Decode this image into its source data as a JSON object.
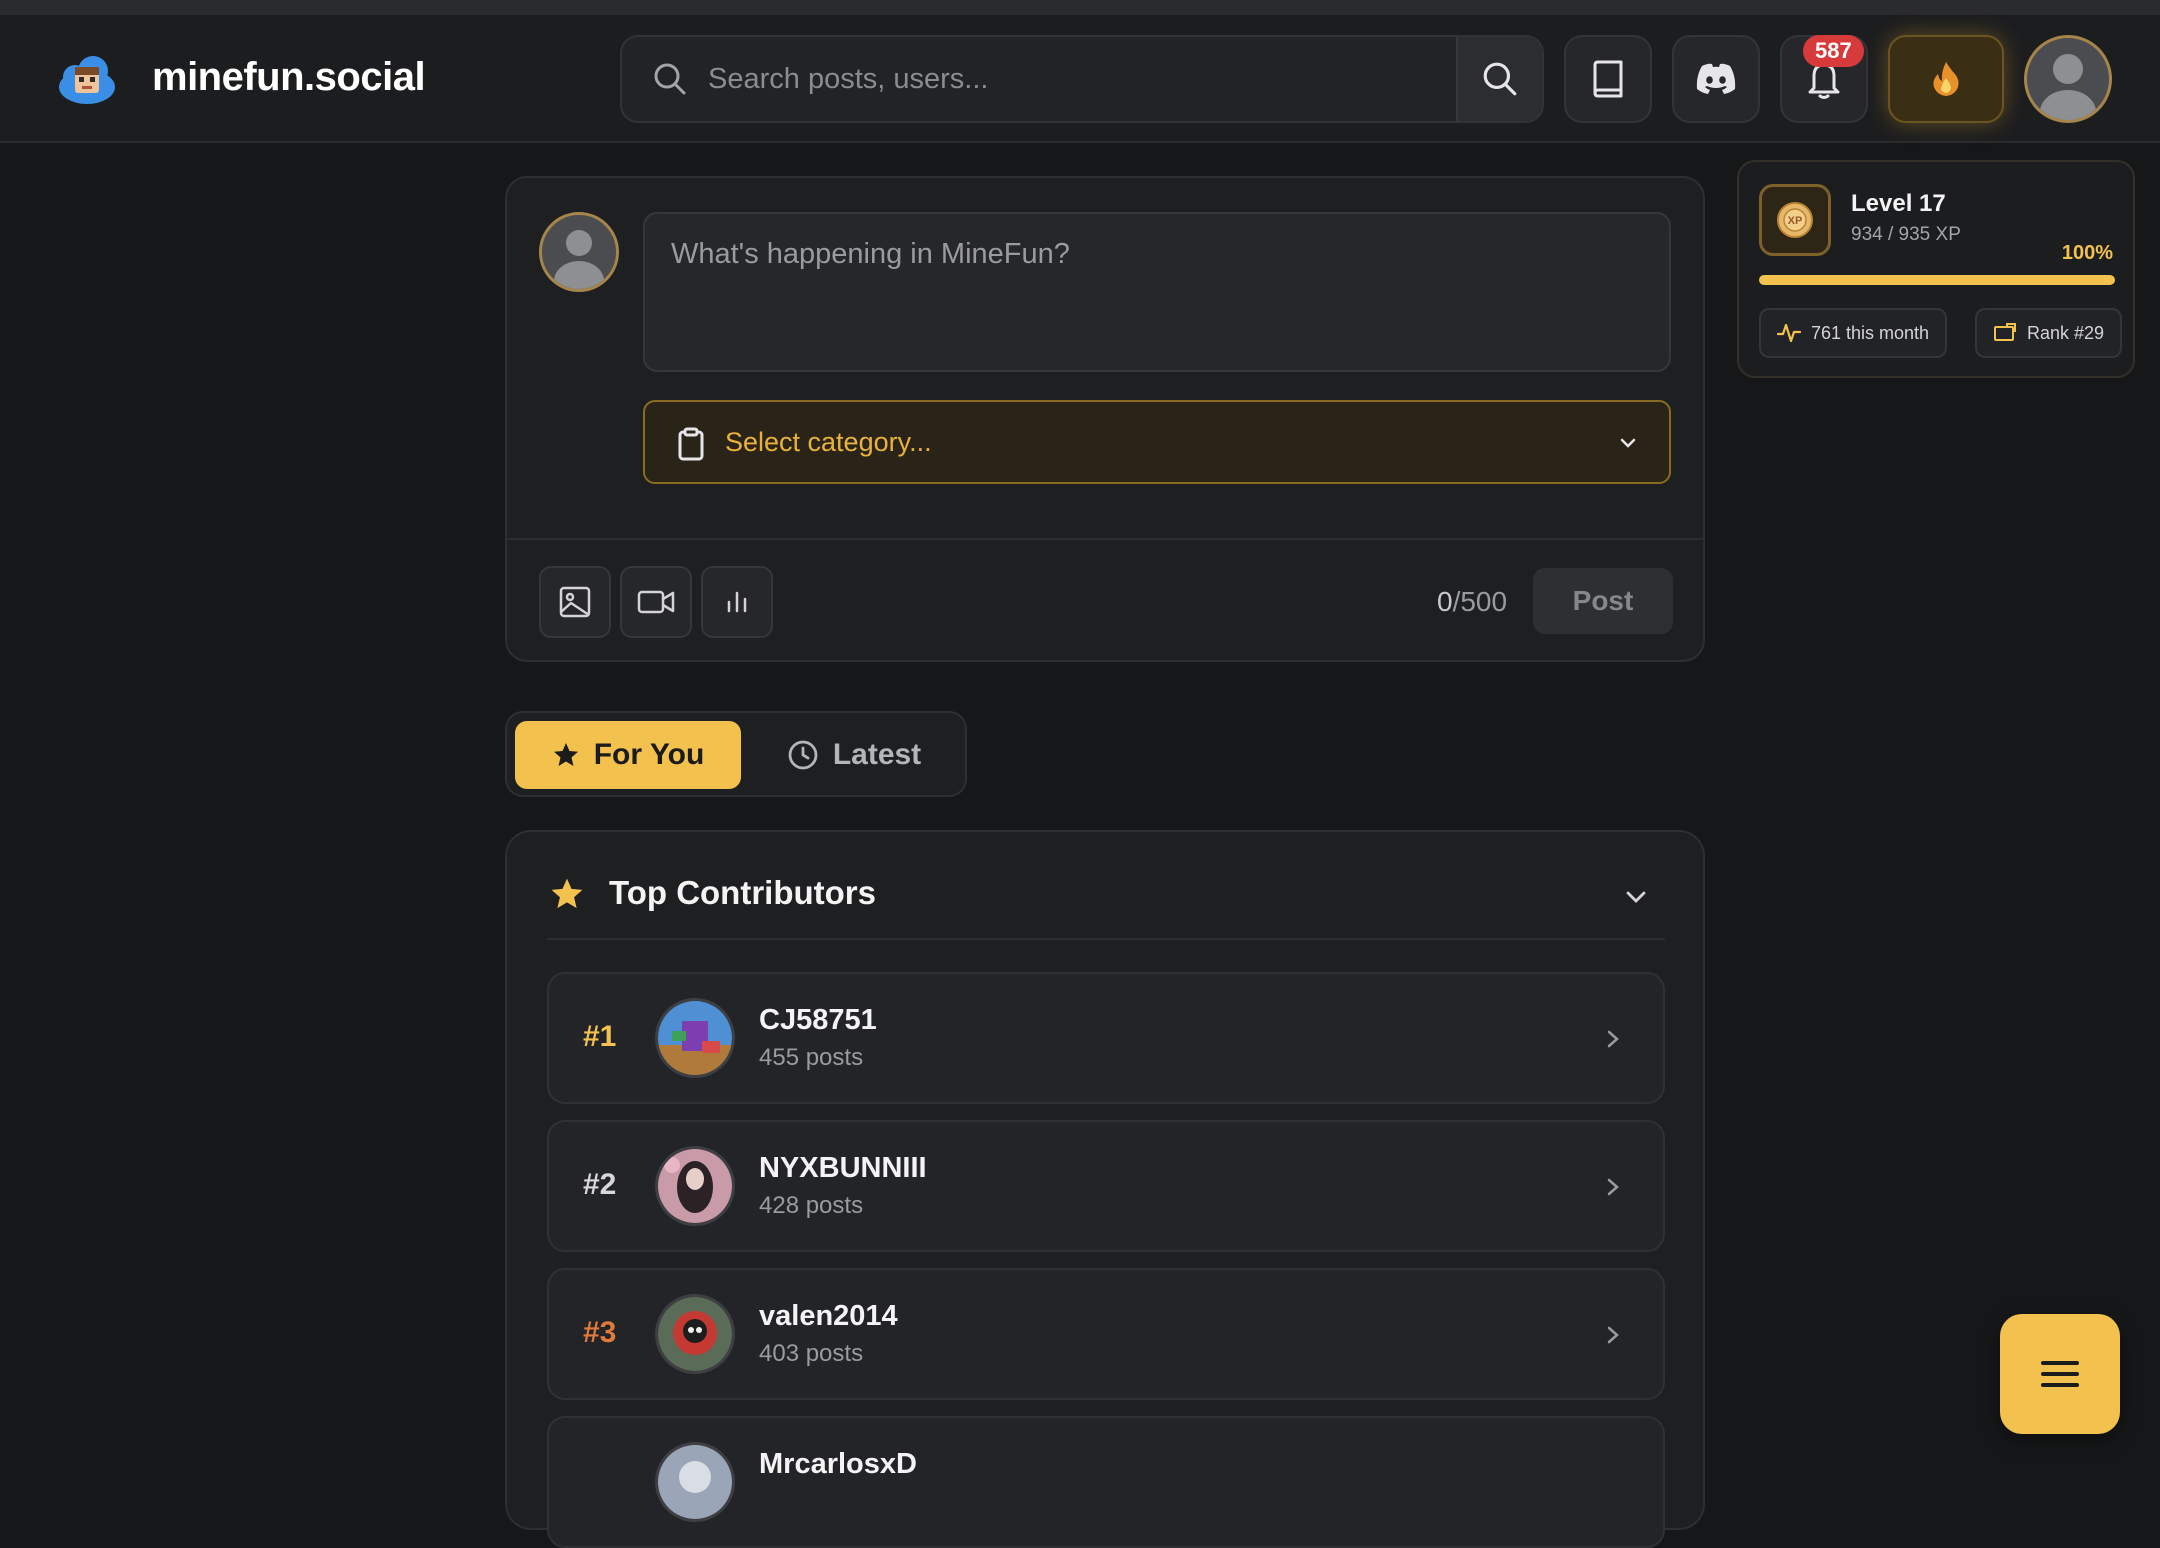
{
  "header": {
    "brand": "minefun.social",
    "search_placeholder": "Search posts, users...",
    "notification_count": "587",
    "icons": [
      "search-icon",
      "book-icon",
      "discord-icon",
      "bell-icon",
      "fire-icon",
      "avatar"
    ]
  },
  "composer": {
    "placeholder": "What's happening in MineFun?",
    "category_placeholder": "Select category...",
    "char_count": "0",
    "char_max": "/500",
    "post_label": "Post",
    "tools": [
      "image-icon",
      "video-icon",
      "poll-icon"
    ]
  },
  "tabs": [
    {
      "label": "For You",
      "active": true,
      "icon": "star-icon"
    },
    {
      "label": "Latest",
      "active": false,
      "icon": "clock-icon"
    }
  ],
  "contributors": {
    "title": "Top Contributors",
    "items": [
      {
        "rank": "#1",
        "name": "CJ58751",
        "posts": "455 posts",
        "rank_color": "#f2c14e"
      },
      {
        "rank": "#2",
        "name": "NYXBUNNIII",
        "posts": "428 posts",
        "rank_color": "#d8d8db"
      },
      {
        "rank": "#3",
        "name": "valen2014",
        "posts": "403 posts",
        "rank_color": "#e07a3a"
      },
      {
        "rank": "",
        "name": "MrcarlosxD",
        "posts": "",
        "rank_color": "#9a9b9f"
      }
    ]
  },
  "xp": {
    "level": "Level 17",
    "progress_text": "934 / 935 XP",
    "percent_label": "100%",
    "progress": 1.0,
    "month_label": "761 this month",
    "rank_label": "Rank #29",
    "accent": "#f2c14e"
  },
  "colors": {
    "accent": "#f2c14e",
    "background": "#161718",
    "badge": "#d63a3a"
  }
}
